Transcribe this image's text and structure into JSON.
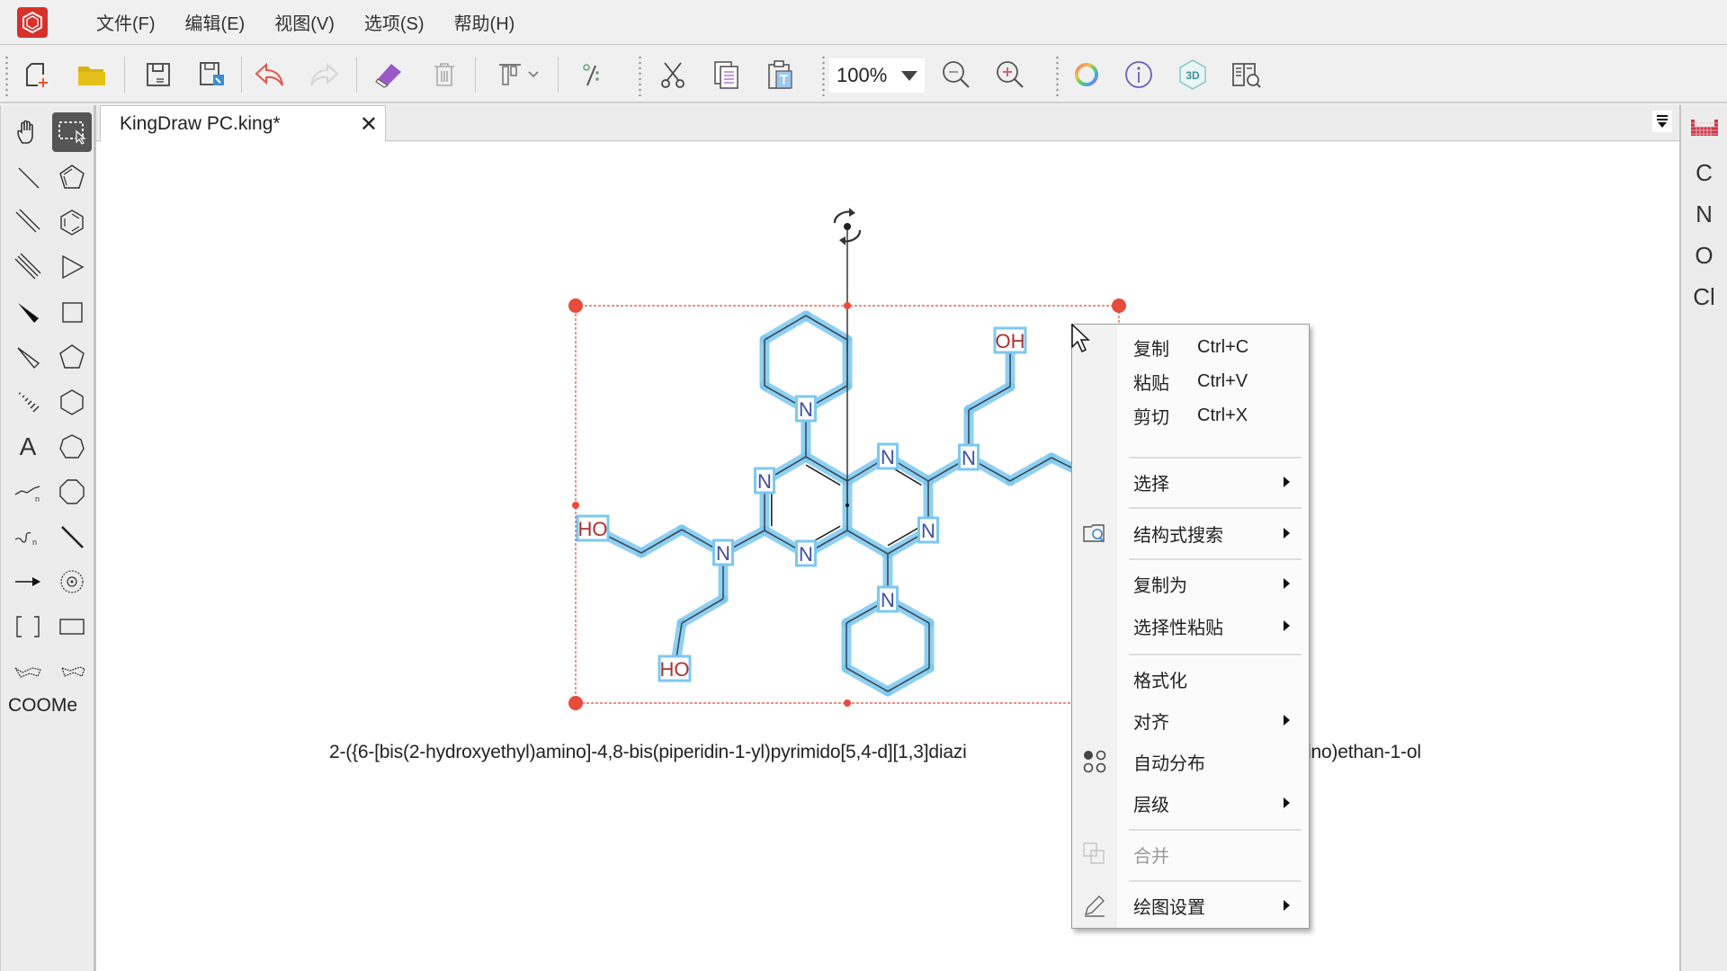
{
  "app": {
    "name": "KingDraw PC",
    "brand_color": "#d9302a"
  },
  "menubar": {
    "items": [
      "文件(F)",
      "编辑(E)",
      "视图(V)",
      "选项(S)",
      "帮助(H)"
    ]
  },
  "toolbar": {
    "buttons": [
      {
        "icon": "new-document-icon"
      },
      {
        "icon": "open-folder-icon"
      },
      {
        "icon": "save-icon"
      },
      {
        "icon": "save-as-icon"
      },
      {
        "icon": "undo-icon"
      },
      {
        "icon": "redo-icon",
        "disabled": true
      },
      {
        "icon": "eraser-icon"
      },
      {
        "icon": "delete-icon",
        "disabled": true
      },
      {
        "icon": "align-dropdown-icon"
      },
      {
        "icon": "charge-icon"
      },
      {
        "icon": "cut-icon"
      },
      {
        "icon": "copy-icon"
      },
      {
        "icon": "paste-icon"
      },
      {
        "icon": "zoom-out-icon"
      },
      {
        "icon": "zoom-in-icon"
      },
      {
        "icon": "color-ring-icon"
      },
      {
        "icon": "info-icon"
      },
      {
        "icon": "3d-icon"
      },
      {
        "icon": "library-search-icon"
      }
    ],
    "zoom_level": "100%",
    "three_d_label": "3D"
  },
  "left_tools": {
    "items": [
      "hand-tool",
      "select-rectangle-tool",
      "single-bond-tool",
      "cyclopentadiene-tool",
      "double-bond-tool",
      "benzene-tool",
      "triple-bond-tool",
      "triangle-ring-tool",
      "wedge-bond-tool",
      "square-ring-tool",
      "hollow-wedge-tool",
      "pentagon-ring-tool",
      "hash-bond-tool",
      "hexagon-ring-tool",
      "text-tool",
      "heptagon-ring-tool",
      "chain-tool",
      "octagon-ring-tool",
      "wavy-chain-tool",
      "bold-bond-tool",
      "arrow-tool",
      "orbital-tool",
      "bracket-tool",
      "rectangle-tool",
      "chair-left-tool",
      "chair-right-tool"
    ],
    "text_tool_label": "A",
    "template_label": "COOMe"
  },
  "tabs": [
    {
      "label": "KingDraw PC.king*",
      "active": true
    }
  ],
  "right_elements": {
    "periodic_table_icon": "periodic-table-icon",
    "items": [
      "C",
      "N",
      "O",
      "Cl"
    ]
  },
  "molecule": {
    "atom_labels": {
      "n_pip_top": "N",
      "n_pip_bottom": "N",
      "n_ring_1": "N",
      "n_ring_3": "N",
      "n_ring_5": "N",
      "n_ring_7": "N",
      "n_amine_left": "N",
      "n_amine_right": "N",
      "oh_top_right": "OH",
      "ho_left": "HO",
      "ho_bottom": "HO"
    },
    "caption": "2-({6-[bis(2-hydroxyethyl)amino]-4,8-bis(piperidin-1-yl)pyrimido[5,4-d][1,3]diazi",
    "caption_tail": "ino)ethan-1-ol",
    "selection_color": "#e84a3c",
    "highlight_color": "#7cc8f0"
  },
  "context_menu": {
    "items": [
      {
        "label": "复制",
        "shortcut": "Ctrl+C"
      },
      {
        "label": "粘贴",
        "shortcut": "Ctrl+V"
      },
      {
        "label": "剪切",
        "shortcut": "Ctrl+X"
      },
      {
        "label": "选择",
        "submenu": true
      },
      {
        "label": "结构式搜索",
        "submenu": true,
        "icon": "structure-search-icon"
      },
      {
        "label": "复制为",
        "submenu": true
      },
      {
        "label": "选择性粘贴",
        "submenu": true
      },
      {
        "label": "格式化"
      },
      {
        "label": "对齐",
        "submenu": true
      },
      {
        "label": "自动分布",
        "icon": "auto-distribute-icon"
      },
      {
        "label": "层级",
        "submenu": true
      },
      {
        "label": "合并",
        "disabled": true,
        "icon": "merge-icon"
      },
      {
        "label": "绘图设置",
        "submenu": true,
        "icon": "pencil-icon"
      }
    ]
  }
}
